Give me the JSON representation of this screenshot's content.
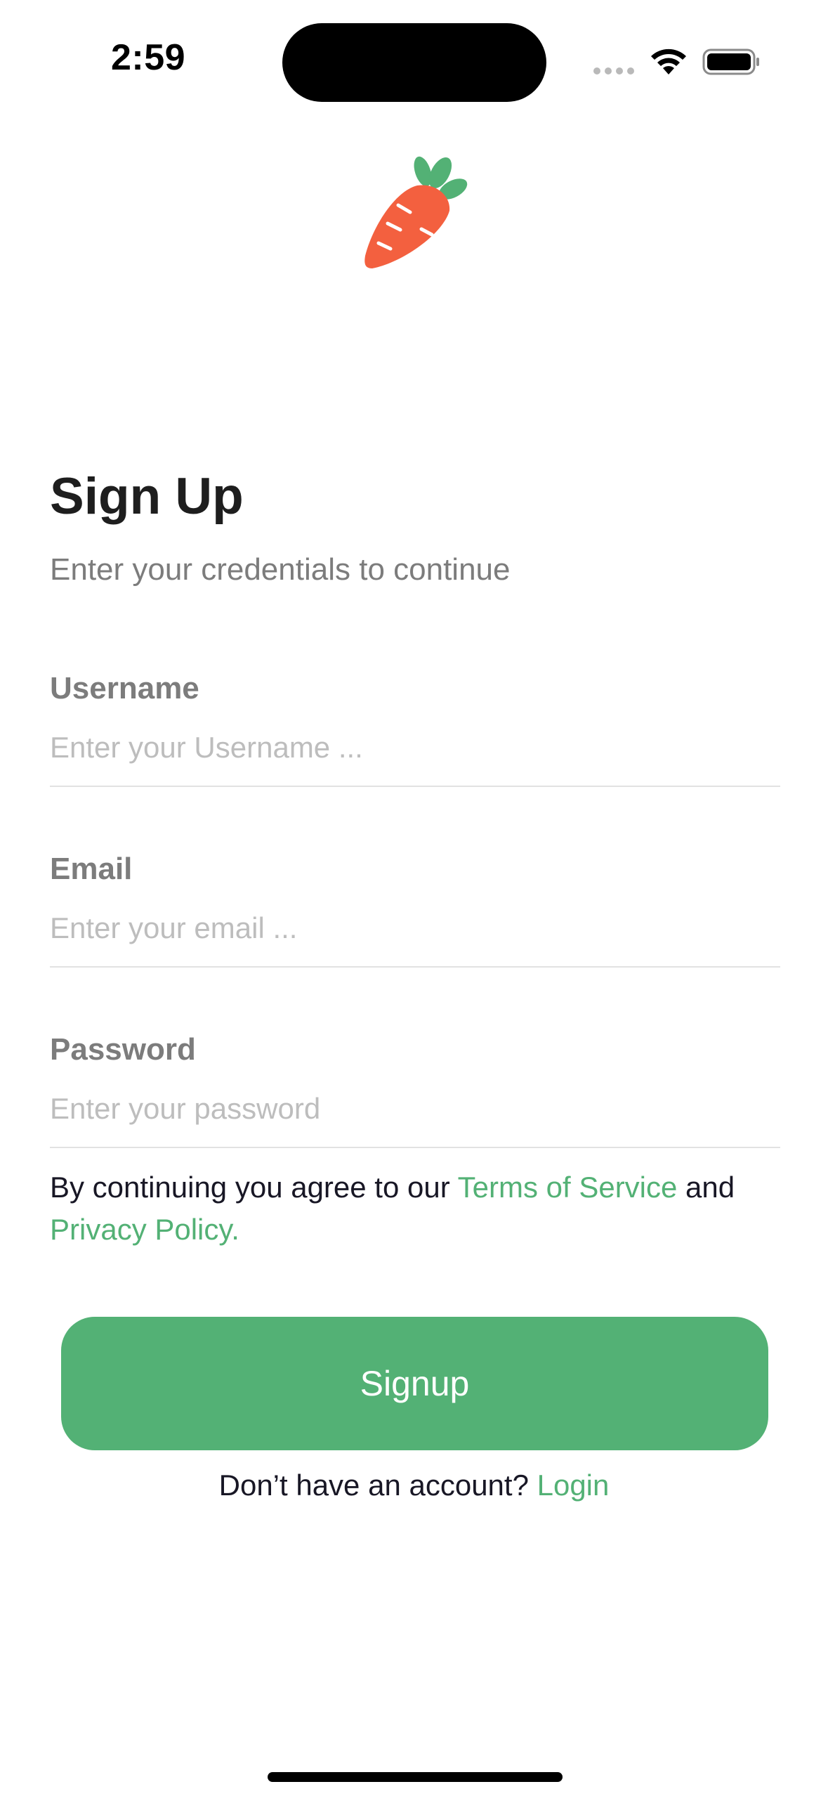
{
  "status_bar": {
    "time": "2:59"
  },
  "logo": {
    "icon": "carrot-icon",
    "colors": {
      "body": "#f3603f",
      "leaves": "#53b175"
    }
  },
  "header": {
    "title": "Sign Up",
    "subtitle": "Enter your credentials to continue"
  },
  "form": {
    "username": {
      "label": "Username",
      "placeholder": "Enter your Username ...",
      "value": ""
    },
    "email": {
      "label": "Email",
      "placeholder": "Enter your email ...",
      "value": ""
    },
    "password": {
      "label": "Password",
      "placeholder": "Enter your password",
      "value": ""
    }
  },
  "terms": {
    "prefix": "By continuing you agree to our ",
    "terms_link": "Terms of Service",
    "middle": " and ",
    "privacy_link": "Privacy Policy."
  },
  "signup_button": {
    "label": "Signup"
  },
  "login_prompt": {
    "text": "Don’t have an account? ",
    "link": "Login"
  },
  "colors": {
    "accent": "#53b175",
    "carrot": "#f3603f",
    "label": "#7c7c7c",
    "placeholder": "#bdbdbd"
  }
}
